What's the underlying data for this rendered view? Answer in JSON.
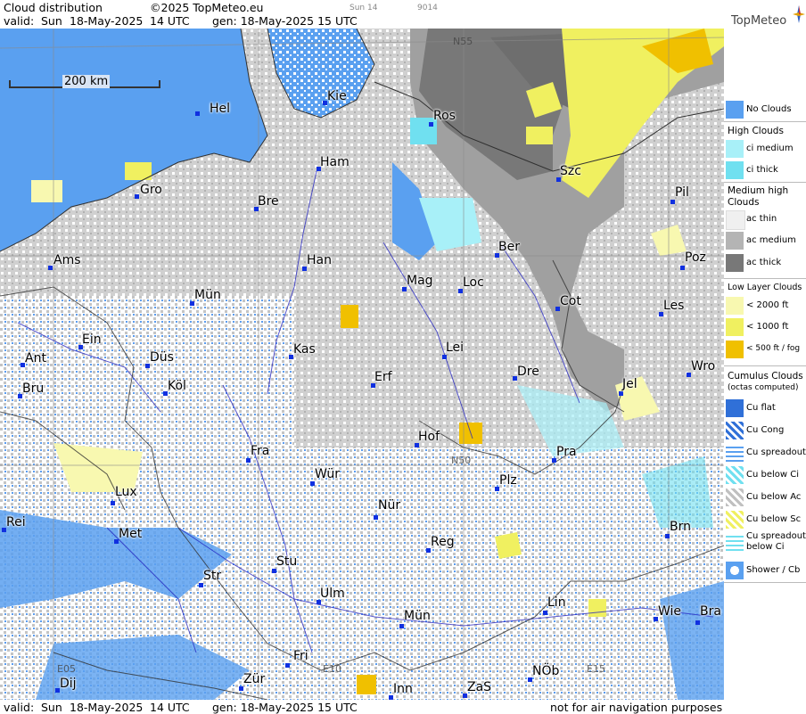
{
  "header": {
    "title": "Cloud distribution",
    "copyright": "©2025 TopMeteo.eu",
    "small1": "Sun 14",
    "small2": "9014",
    "valid_label": "valid:",
    "valid_day": "Sun",
    "valid_date": "18-May-2025",
    "valid_time": "14 UTC",
    "gen": "gen: 18-May-2025 15 UTC",
    "logo": "TopMeteo"
  },
  "footer": {
    "valid_label": "valid:",
    "valid_day": "Sun",
    "valid_date": "18-May-2025",
    "valid_time": "14 UTC",
    "gen": "gen: 18-May-2025 15 UTC",
    "note": "not for air navigation purposes"
  },
  "map": {
    "scale_label": "200 km",
    "grid_labels": [
      "N55",
      "N50",
      "E05",
      "E10",
      "E15"
    ],
    "cities": [
      "Hel",
      "Kie",
      "Ros",
      "Ham",
      "Szc",
      "Gro",
      "Bre",
      "Pil",
      "Ber",
      "Ams",
      "Han",
      "Mag",
      "Loc",
      "Poz",
      "Mün",
      "Cot",
      "Les",
      "Ein",
      "Kas",
      "Lei",
      "Ant",
      "Düs",
      "Dre",
      "Wro",
      "Erf",
      "Köl",
      "Bru",
      "Jel",
      "Hof",
      "Fra",
      "Pra",
      "Wür",
      "Plz",
      "Lux",
      "Nür",
      "Rei",
      "Met",
      "Reg",
      "Brn",
      "Stu",
      "Str",
      "Ulm",
      "Lin",
      "Wie",
      "Bra",
      "Mün",
      "Fri",
      "NÖb",
      "Dij",
      "Zür",
      "Inn",
      "ZaS"
    ]
  },
  "legend": {
    "no_clouds": "No Clouds",
    "high_head": "High Clouds",
    "ci_medium": "ci medium",
    "ci_thick": "ci thick",
    "mid_head_1": "Medium high",
    "mid_head_2": "Clouds",
    "ac_thin": "ac thin",
    "ac_medium": "ac medium",
    "ac_thick": "ac thick",
    "low_head": "Low Layer Clouds",
    "low_2000": "< 2000 ft",
    "low_1000": "< 1000 ft",
    "low_500": "< 500 ft / fog",
    "cu_head_1": "Cumulus Clouds",
    "cu_head_2": "(octas computed)",
    "cu_flat": "Cu flat",
    "cu_cong": "Cu Cong",
    "cu_spread": "Cu spreadout",
    "cu_below_ci": "Cu below Ci",
    "cu_below_ac": "Cu below Ac",
    "cu_below_sc": "Cu below Sc",
    "cu_spread_ci_1": "Cu spreadout",
    "cu_spread_ci_2": "below Ci",
    "shower": "Shower / Cb"
  },
  "colors": {
    "no_clouds": "#5aa0f0",
    "ci_medium": "#a8f0f8",
    "ci_thick": "#70e0f0",
    "ac_thin": "#f0f0f0",
    "ac_medium": "#b4b4b4",
    "ac_thick": "#787878",
    "low_2000": "#f8f8b0",
    "low_1000": "#f0f060",
    "low_500": "#f0c000",
    "cu_flat": "#3070d8",
    "cu_below_ac": "#c0c0c0",
    "background_cloud": "#d2d2d2"
  }
}
